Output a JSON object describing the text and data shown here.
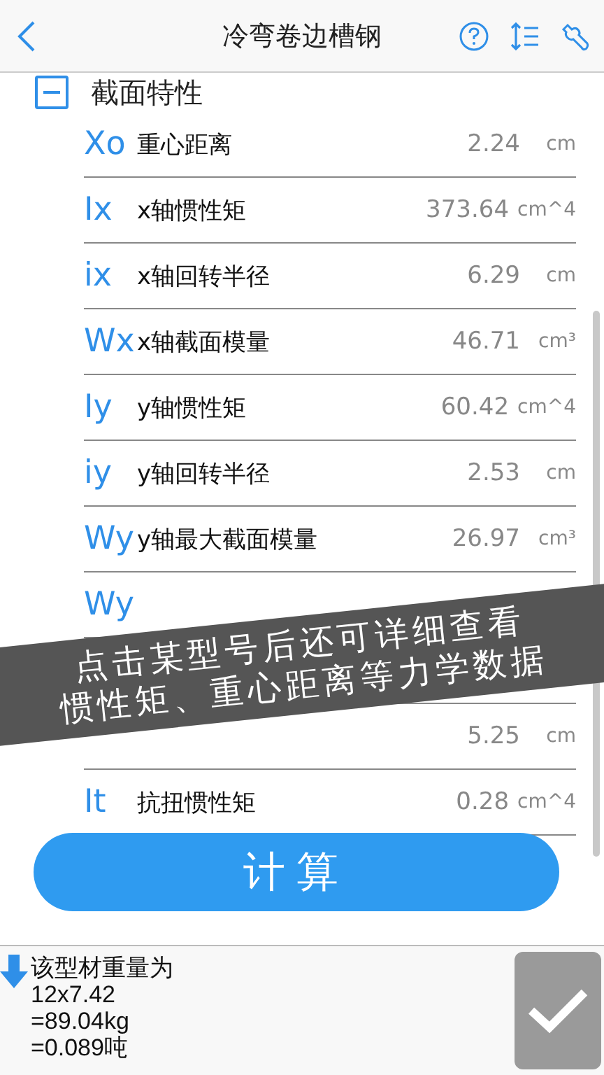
{
  "header": {
    "title": "冷弯卷边槽钢"
  },
  "section": {
    "title": "截面特性",
    "expanded": true
  },
  "rows": [
    {
      "symbol": "Xo",
      "name": "重心距离",
      "value": "2.24",
      "unit": "cm"
    },
    {
      "symbol": "Ix",
      "name": "x轴惯性矩",
      "value": "373.64",
      "unit": "cm^4"
    },
    {
      "symbol": "ix",
      "name": "x轴回转半径",
      "value": "6.29",
      "unit": "cm"
    },
    {
      "symbol": "Wx",
      "name": "x轴截面模量",
      "value": "46.71",
      "unit": "cm³"
    },
    {
      "symbol": "Iy",
      "name": "y轴惯性矩",
      "value": "60.42",
      "unit": "cm^4"
    },
    {
      "symbol": "iy",
      "name": "y轴回转半径",
      "value": "2.53",
      "unit": "cm"
    },
    {
      "symbol": "Wy",
      "name": "y轴最大截面模量",
      "value": "26.97",
      "unit": "cm³"
    },
    {
      "symbol": "Wy"
    },
    {},
    {
      "value": "5.25",
      "unit": "cm"
    },
    {
      "symbol": "It",
      "name": "抗扭惯性矩",
      "value": "0.28",
      "unit": "cm^4"
    }
  ],
  "banner": {
    "lines": [
      "点击某型号后还可详细查看",
      "惯性矩、重心距离等力学数据"
    ]
  },
  "calc_button": {
    "label": "计算"
  },
  "result": {
    "lines": [
      "该型材重量为",
      "12x7.42",
      "=89.04kg",
      "=0.089吨"
    ]
  }
}
